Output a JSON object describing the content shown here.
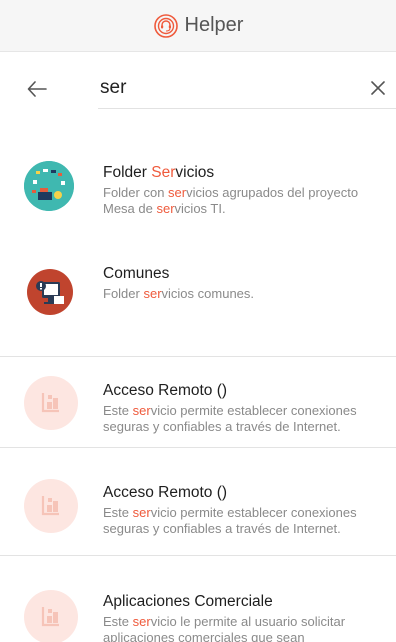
{
  "app": {
    "title": "Helper"
  },
  "search": {
    "query": "ser",
    "placeholder": ""
  },
  "results": [
    {
      "title_pre": "Folder ",
      "title_hl": "Ser",
      "title_post": "vicios",
      "desc": [
        {
          "t": "Folder con "
        },
        {
          "t": "ser",
          "hl": true
        },
        {
          "t": "vicios agrupados del proyecto Mesa de "
        },
        {
          "t": "ser",
          "hl": true
        },
        {
          "t": "vicios TI."
        }
      ],
      "icon": "folder-servicios-icon"
    },
    {
      "title_pre": "Comunes",
      "title_hl": "",
      "title_post": "",
      "desc": [
        {
          "t": "Folder "
        },
        {
          "t": "ser",
          "hl": true
        },
        {
          "t": "vicios comunes."
        }
      ],
      "icon": "comunes-icon"
    },
    {
      "title_pre": "Acceso Remoto ()",
      "title_hl": "",
      "title_post": "",
      "desc": [
        {
          "t": "Este "
        },
        {
          "t": "ser",
          "hl": true
        },
        {
          "t": "vicio permite establecer conexiones seguras y confiables a través de Internet."
        }
      ],
      "icon": "service-placeholder-icon"
    },
    {
      "title_pre": "Acceso Remoto ()",
      "title_hl": "",
      "title_post": "",
      "desc": [
        {
          "t": "Este "
        },
        {
          "t": "ser",
          "hl": true
        },
        {
          "t": "vicio permite establecer conexiones seguras y confiables a través de Internet."
        }
      ],
      "icon": "service-placeholder-icon"
    },
    {
      "title_pre": "Aplicaciones Comerciale",
      "title_hl": "",
      "title_post": "",
      "desc": [
        {
          "t": "Este "
        },
        {
          "t": "ser",
          "hl": true
        },
        {
          "t": "vicio le permite al usuario solicitar aplicaciones comerciales que sean"
        }
      ],
      "icon": "service-placeholder-icon"
    }
  ],
  "colors": {
    "highlight": "#ef5a3c",
    "brand": "#ef5a3c",
    "placeholder_icon_bg": "#fde6e1"
  }
}
